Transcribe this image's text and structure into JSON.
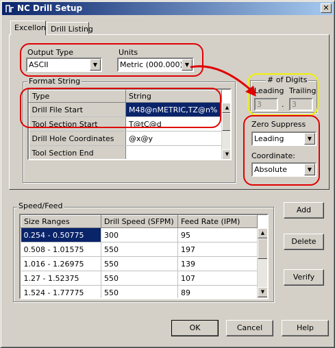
{
  "window": {
    "title": "NC Drill Setup",
    "close_glyph": "✕"
  },
  "tabs": [
    {
      "label": "Excellon",
      "active": true
    },
    {
      "label": "Drill Listing",
      "active": false
    }
  ],
  "output_type": {
    "label": "Output Type",
    "value": "ASCII"
  },
  "units": {
    "label": "Units",
    "value": "Metric (000.000)"
  },
  "format_string": {
    "label": "Format String",
    "headers": [
      "Type",
      "String"
    ],
    "rows": [
      {
        "type": "Drill File Start",
        "string": "M48@nMETRIC,TZ@n%"
      },
      {
        "type": "Tool Section Start",
        "string": "T@tC@d"
      },
      {
        "type": "Drill Hole Coordinates",
        "string": "@x@y"
      },
      {
        "type": "Tool Section End",
        "string": ""
      }
    ]
  },
  "digits": {
    "label": "# of Digits",
    "leading_label": "Leading",
    "trailing_label": "Trailing",
    "leading_value": "3",
    "separator": ".",
    "trailing_value": "3"
  },
  "zero_suppress": {
    "label": "Zero Suppress",
    "value": "Leading"
  },
  "coordinate": {
    "label": "Coordinate:",
    "value": "Absolute"
  },
  "speed_feed": {
    "label": "Speed/Feed",
    "headers": [
      "Size Ranges",
      "Drill Speed (SFPM)",
      "Feed Rate (IPM)"
    ],
    "rows": [
      {
        "range": "0.254 - 0.50775",
        "speed": "300",
        "feed": "95"
      },
      {
        "range": "0.508 - 1.01575",
        "speed": "550",
        "feed": "197"
      },
      {
        "range": "1.016 - 1.26975",
        "speed": "550",
        "feed": "139"
      },
      {
        "range": "1.27 - 1.52375",
        "speed": "550",
        "feed": "107"
      },
      {
        "range": "1.524 - 1.77775",
        "speed": "550",
        "feed": "89"
      }
    ]
  },
  "buttons": {
    "add": "Add",
    "delete": "Delete",
    "verify": "Verify",
    "ok": "OK",
    "cancel": "Cancel",
    "help": "Help"
  },
  "colors": {
    "annotation_red": "#e00000",
    "annotation_yellow": "#f2f200",
    "selection": "#0a246a"
  }
}
